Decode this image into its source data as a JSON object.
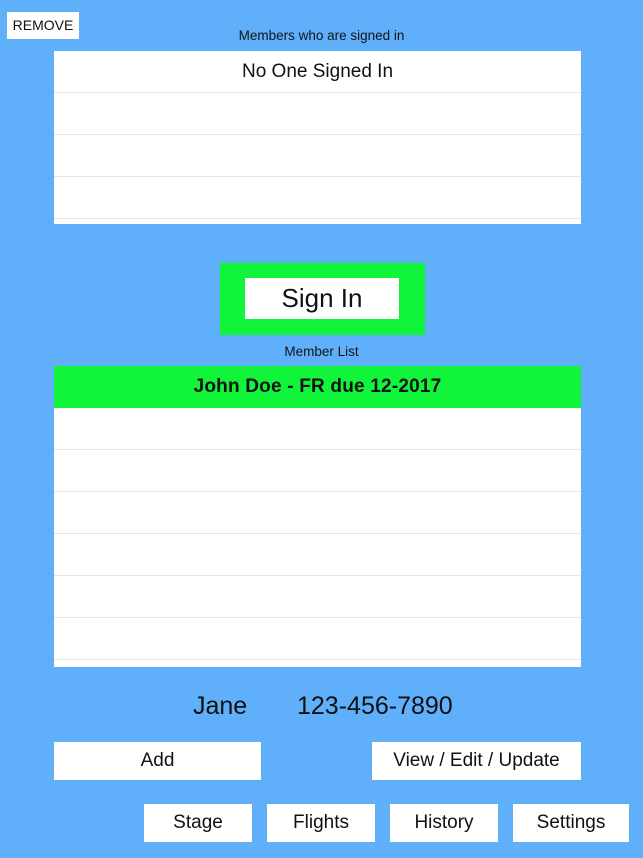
{
  "colors": {
    "background": "#5FAFFB",
    "accent_green": "#10F53A",
    "panel": "#FFFFFF",
    "text": "#111111",
    "separator": "#E4E4E6"
  },
  "toolbar": {
    "remove_label": "REMOVE"
  },
  "signed_in_section": {
    "caption": "Members who are signed in",
    "rows": [
      "No One Signed In",
      "",
      "",
      ""
    ]
  },
  "sign_in": {
    "label": "Sign In"
  },
  "member_section": {
    "caption": "Member List",
    "rows": [
      {
        "text": "John Doe   -   FR due 12-2017",
        "selected": true
      },
      {
        "text": "",
        "selected": false
      },
      {
        "text": "",
        "selected": false
      },
      {
        "text": "",
        "selected": false
      },
      {
        "text": "",
        "selected": false
      },
      {
        "text": "",
        "selected": false
      },
      {
        "text": "",
        "selected": false
      }
    ]
  },
  "selected_member_details": {
    "name": "Jane",
    "phone": "123-456-7890"
  },
  "actions": {
    "add_label": "Add",
    "view_edit_update_label": "View / Edit / Update"
  },
  "bottom_nav": {
    "stage_label": "Stage",
    "flights_label": "Flights",
    "history_label": "History",
    "settings_label": "Settings"
  }
}
